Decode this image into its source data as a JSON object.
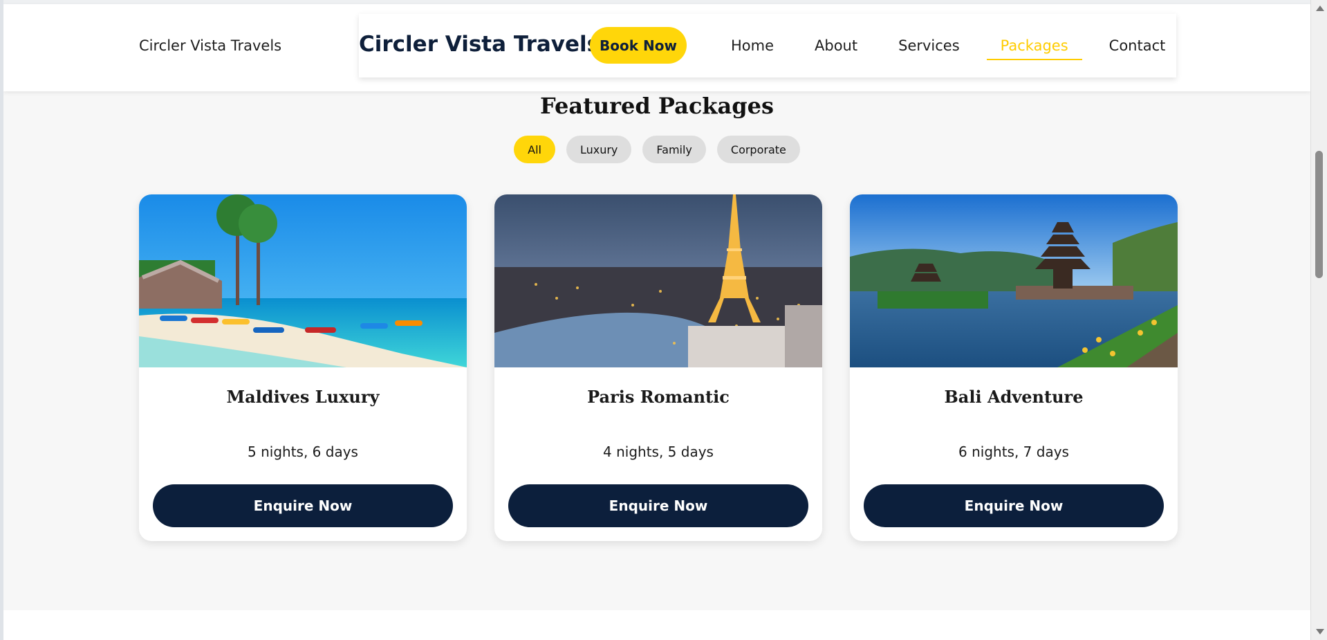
{
  "header": {
    "brand_small": "Circler Vista Travels",
    "brand_big": "Circler Vista Travels",
    "book_now": "Book Now",
    "nav": [
      {
        "label": "Home"
      },
      {
        "label": "About"
      },
      {
        "label": "Services"
      },
      {
        "label": "Packages",
        "active": true
      },
      {
        "label": "Contact"
      }
    ]
  },
  "section": {
    "title": "Featured Packages",
    "filters": [
      {
        "label": "All",
        "active": true
      },
      {
        "label": "Luxury"
      },
      {
        "label": "Family"
      },
      {
        "label": "Corporate"
      }
    ]
  },
  "cards": [
    {
      "title": "Maldives Luxury",
      "meta": "5 nights, 6 days",
      "button": "Enquire Now",
      "image": "maldives-beach-photo"
    },
    {
      "title": "Paris Romantic",
      "meta": "4 nights, 5 days",
      "button": "Enquire Now",
      "image": "paris-eiffel-night-photo"
    },
    {
      "title": "Bali Adventure",
      "meta": "6 nights, 7 days",
      "button": "Enquire Now",
      "image": "bali-temple-lake-photo"
    }
  ],
  "colors": {
    "accent": "#ffd60a",
    "navy": "#0c1f3c",
    "active_nav": "#ffcc00"
  }
}
